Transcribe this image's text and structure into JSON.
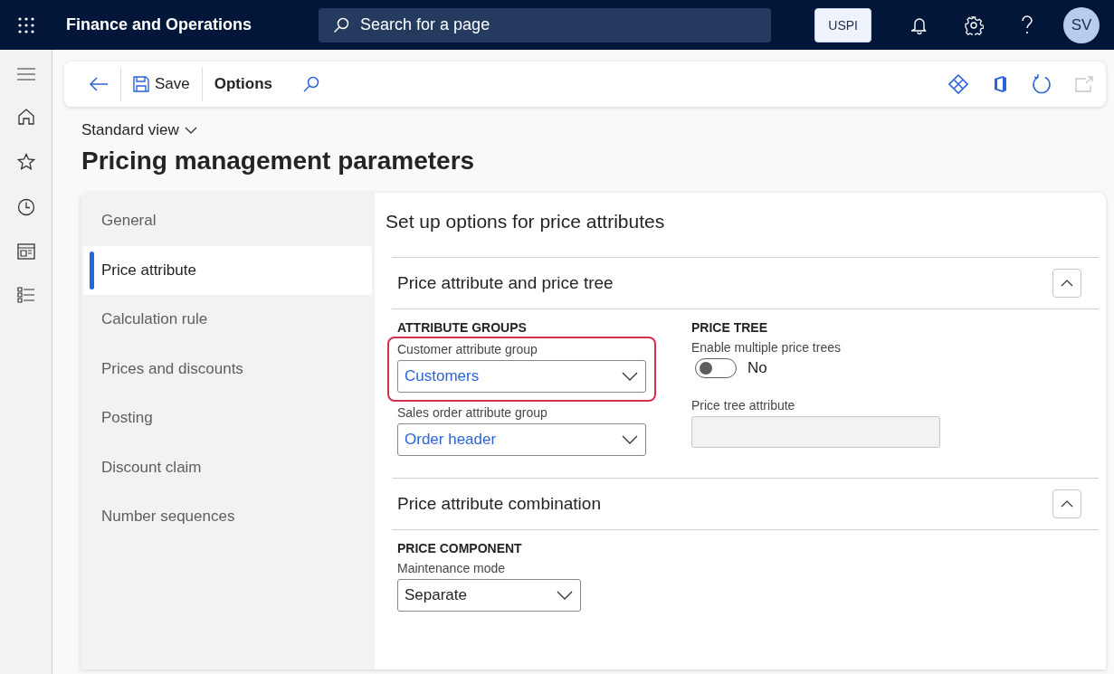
{
  "top_bar": {
    "app_name": "Finance and Operations",
    "search": {
      "placeholder": "Search for a page"
    },
    "company": "USPI",
    "avatar": "SV"
  },
  "nav_rail": {
    "items": [
      {
        "kind": "menu"
      },
      {
        "kind": "home"
      },
      {
        "kind": "star"
      },
      {
        "kind": "clock"
      },
      {
        "kind": "workspace"
      },
      {
        "kind": "list"
      }
    ]
  },
  "toolbar": {
    "save": "Save",
    "options": "Options"
  },
  "view_selector": "Standard view",
  "page_title": "Pricing management parameters",
  "tabs": [
    {
      "label": "General",
      "selected": false
    },
    {
      "label": "Price attribute",
      "selected": true
    },
    {
      "label": "Calculation rule",
      "selected": false
    },
    {
      "label": "Prices and discounts",
      "selected": false
    },
    {
      "label": "Posting",
      "selected": false
    },
    {
      "label": "Discount claim",
      "selected": false
    },
    {
      "label": "Number sequences",
      "selected": false
    }
  ],
  "pane_title": "Set up options for price attributes",
  "sections": [
    {
      "title": "Price attribute and price tree",
      "expanded": true,
      "groups": [
        {
          "heading": "ATTRIBUTE GROUPS",
          "fields": [
            {
              "kind": "dropdown",
              "label": "Customer attribute group",
              "value": "Customers",
              "highlighted": true
            },
            {
              "kind": "dropdown",
              "label": "Sales order attribute group",
              "value": "Order header",
              "highlighted": false
            }
          ]
        },
        {
          "heading": "PRICE TREE",
          "fields": [
            {
              "kind": "toggle",
              "label": "Enable multiple price trees",
              "on": false,
              "value": "No"
            },
            {
              "kind": "text",
              "label": "Price tree attribute",
              "disabled": true
            }
          ]
        }
      ]
    },
    {
      "title": "Price attribute combination",
      "expanded": true,
      "groups": [
        {
          "heading": "PRICE COMPONENT",
          "fields": [
            {
              "kind": "dropdown",
              "label": "Maintenance mode",
              "value": "Separate",
              "highlighted": false,
              "plain": true
            }
          ]
        }
      ]
    }
  ]
}
